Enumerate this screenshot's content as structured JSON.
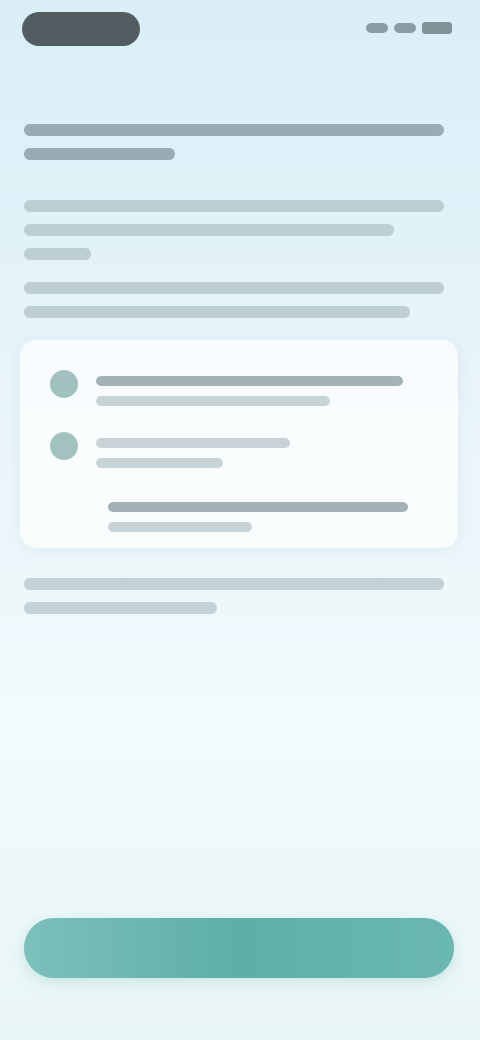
{
  "status_bar": {
    "time": "",
    "icons": [
      "signal-icon",
      "wifi-icon",
      "battery-icon"
    ]
  },
  "content": {
    "paragraph_1": "",
    "paragraph_2": "",
    "paragraph_3": "",
    "paragraph_4": ""
  },
  "card": {
    "options": [
      {
        "icon": "check-circle-icon",
        "label": ""
      },
      {
        "icon": "check-circle-icon",
        "label": ""
      },
      {
        "icon": "",
        "label": ""
      }
    ]
  },
  "cta": {
    "label": ""
  },
  "colors": {
    "accent": "#5eaea9",
    "background_top": "#d9eef7",
    "background_bottom": "#e9f6f6",
    "card": "#ffffff"
  }
}
